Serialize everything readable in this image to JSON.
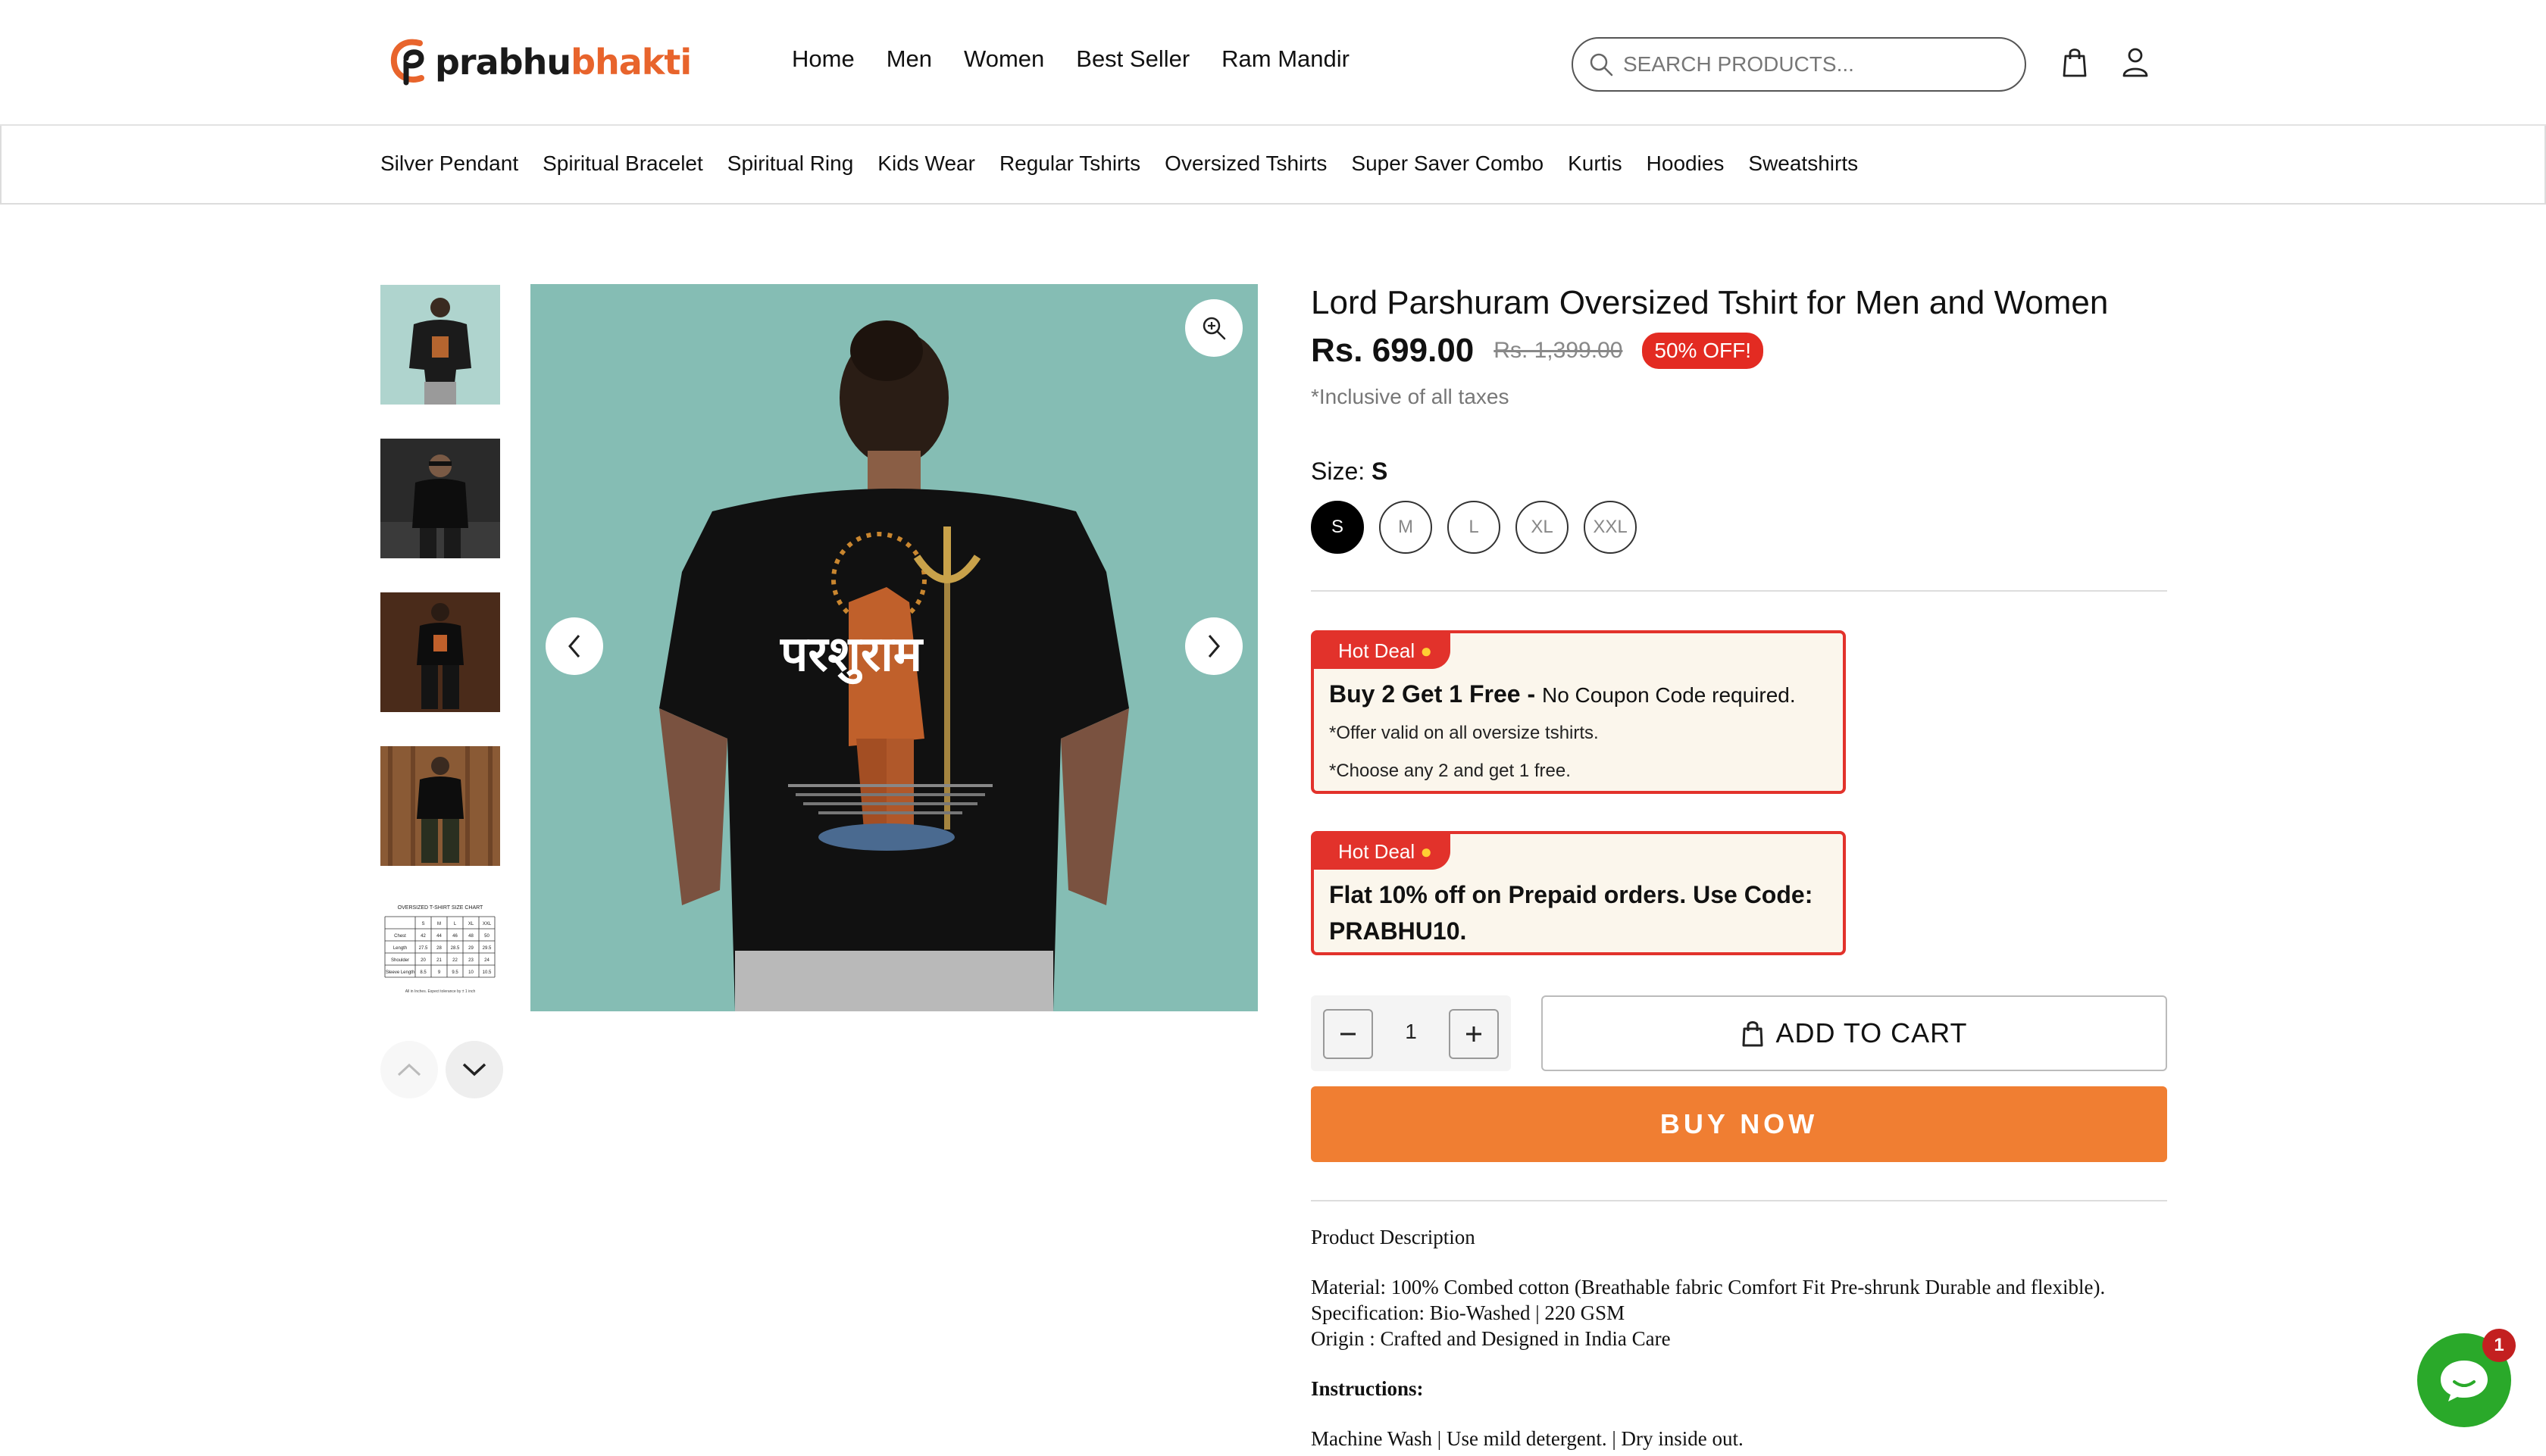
{
  "brand": {
    "name_part1": "prabhu",
    "name_part2": "bhakti",
    "accent": "#e8642c"
  },
  "header": {
    "nav": [
      "Home",
      "Men",
      "Women",
      "Best Seller",
      "Ram Mandir"
    ],
    "search_placeholder": "SEARCH PRODUCTS...",
    "icons": [
      "search-icon",
      "cart-bag-icon",
      "user-icon"
    ]
  },
  "categories": [
    "Silver Pendant",
    "Spiritual Bracelet",
    "Spiritual Ring",
    "Kids Wear",
    "Regular Tshirts",
    "Oversized Tshirts",
    "Super Saver Combo",
    "Kurtis",
    "Hoodies",
    "Sweatshirts"
  ],
  "gallery": {
    "thumb_count": 5,
    "main_background": "#85bdb4",
    "print_text": "परशुराम"
  },
  "product": {
    "title": "Lord Parshuram Oversized Tshirt for Men and Women",
    "price": "Rs. 699.00",
    "compare_price": "Rs. 1,399.00",
    "discount": "50% OFF!",
    "taxes_note": "*Inclusive of all taxes",
    "size_label": "Size: ",
    "selected_size": "S",
    "sizes": [
      "S",
      "M",
      "L",
      "XL",
      "XXL"
    ]
  },
  "deals": [
    {
      "tag": "Hot Deal",
      "headline": "Buy 2 Get 1 Free - ",
      "headline_note": "No Coupon Code required.",
      "lines": [
        "*Offer valid on all oversize tshirts.",
        "*Choose any 2 and get 1 free."
      ]
    },
    {
      "tag": "Hot Deal",
      "headline_line1": "Flat 10% off on Prepaid orders. Use Code:",
      "headline_line2": "PRABHU10."
    }
  ],
  "cart": {
    "quantity": "1",
    "add_to_cart": "ADD TO CART",
    "buy_now": "BUY NOW",
    "buy_color": "#f07e32"
  },
  "description": {
    "heading": "Product Description",
    "material": "Material: 100% Combed cotton (Breathable fabric Comfort Fit Pre-shrunk Durable and flexible).",
    "specification": "Specification: Bio-Washed | 220 GSM",
    "origin": "Origin : Crafted and Designed in India Care",
    "instructions_heading": "Instructions:",
    "instructions": "Machine Wash | Use mild detergent. | Dry inside out."
  },
  "chat": {
    "badge_count": "1",
    "color": "#2aa92a"
  },
  "size_chart": {
    "title": "OVERSIZED T-SHIRT SIZE CHART",
    "sizes": [
      "S",
      "M",
      "L",
      "XL",
      "XXL"
    ],
    "rows": [
      {
        "label": "Chest",
        "values": [
          "42",
          "44",
          "46",
          "48",
          "50"
        ]
      },
      {
        "label": "Length",
        "values": [
          "27.5",
          "28",
          "28.5",
          "29",
          "29.5"
        ]
      },
      {
        "label": "Shoulder",
        "values": [
          "20",
          "21",
          "22",
          "23",
          "24"
        ]
      },
      {
        "label": "Sleeve Length",
        "values": [
          "8.5",
          "9",
          "9.5",
          "10",
          "10.5"
        ]
      }
    ],
    "note": "All in Inches. Expect tolerance by ± 1 inch"
  }
}
